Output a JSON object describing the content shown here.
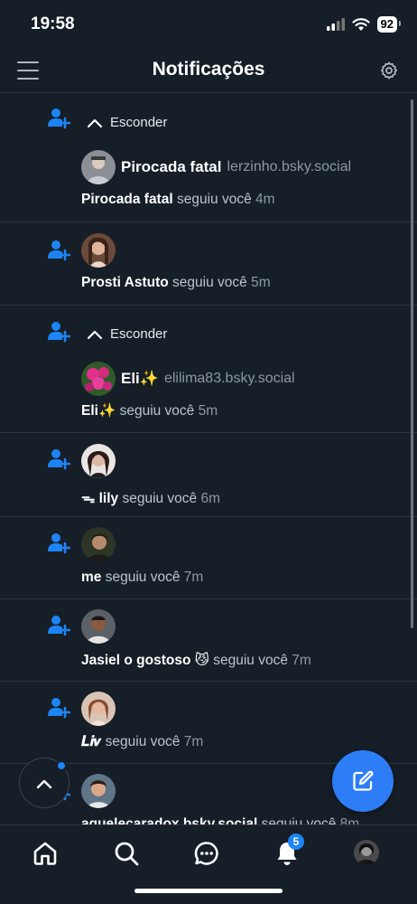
{
  "status": {
    "time": "19:58",
    "battery": "92"
  },
  "header": {
    "title": "Notificações"
  },
  "notifications": [
    {
      "collapse_label": "Esconder",
      "profile_name": "Pirocada fatal",
      "profile_handle": "lerzinho.bsky.social",
      "actor": "Pirocada fatal",
      "action": "seguiu você",
      "time": "4m"
    },
    {
      "actor": "Prosti Astuto",
      "action": "seguiu você",
      "time": "5m"
    },
    {
      "collapse_label": "Esconder",
      "profile_name": "Eli✨",
      "profile_handle": "elilima83.bsky.social",
      "actor": "Eli✨",
      "action": "seguiu você",
      "time": "5m"
    },
    {
      "actor": "ᯓ lily",
      "action": "seguiu você",
      "time": "6m"
    },
    {
      "actor": "me",
      "action": "seguiu você",
      "time": "7m"
    },
    {
      "actor": "Jasiel o gostoso 😼",
      "action": "seguiu você",
      "time": "7m"
    },
    {
      "actor": "𝑳𝒊𝒗",
      "action": "seguiu você",
      "time": "7m"
    },
    {
      "actor": "aquelecaradox.bsky.social",
      "action": "seguiu você",
      "time": "8m"
    }
  ],
  "tabbar": {
    "notifications_badge": "5"
  },
  "icons": [
    "hamburger-icon",
    "gear-icon",
    "follow-icon",
    "chevron-up-icon",
    "compose-icon",
    "home-icon",
    "search-icon",
    "chat-icon",
    "bell-icon"
  ],
  "colors": {
    "background": "#161e27",
    "accent": "#1d84f5",
    "compose": "#2d7df6"
  }
}
